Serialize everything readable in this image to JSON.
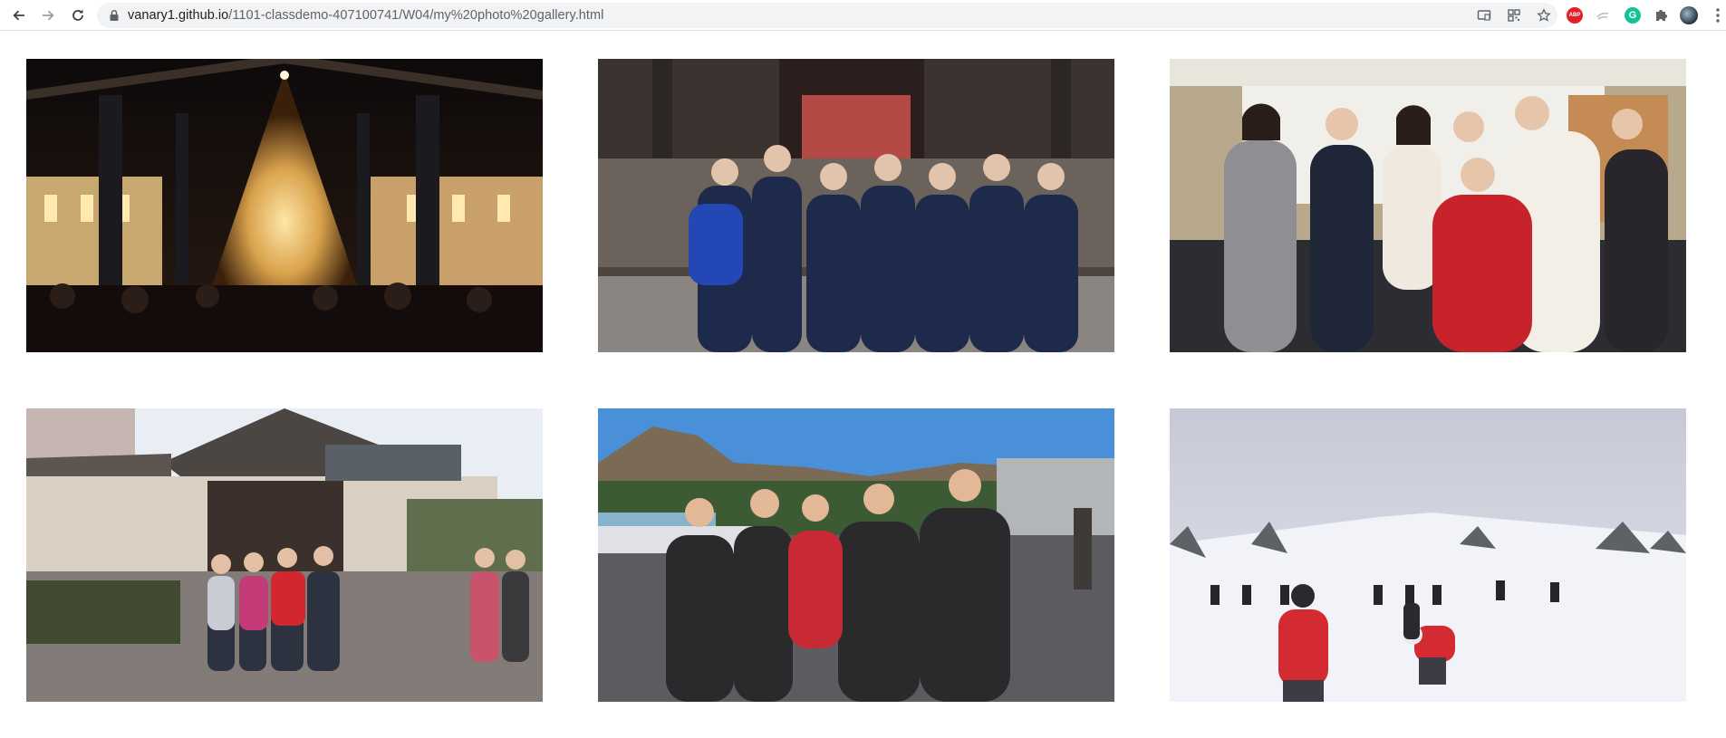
{
  "browser": {
    "url_host": "vanary1.github.io",
    "url_path": "/1101-classdemo-407100741/W04/my%20photo%20gallery.html",
    "icons": [
      "back-icon",
      "forward-icon",
      "reload-icon",
      "lock-icon",
      "install-icon",
      "qr-icon",
      "bookmark-star-icon",
      "adblock-icon",
      "extension-icon",
      "grammarly-icon",
      "puzzle-icon",
      "profile-avatar",
      "kebab-menu-icon"
    ],
    "adblock_label": "ABP",
    "grammarly_label": "G"
  },
  "gallery": {
    "photos": [
      {
        "subject": "christmas-tree-night"
      },
      {
        "subject": "students-temple-gate"
      },
      {
        "subject": "group-indoor-event"
      },
      {
        "subject": "family-japanese-house"
      },
      {
        "subject": "group-parking-lot-mountain"
      },
      {
        "subject": "ski-slope-snow"
      }
    ]
  }
}
